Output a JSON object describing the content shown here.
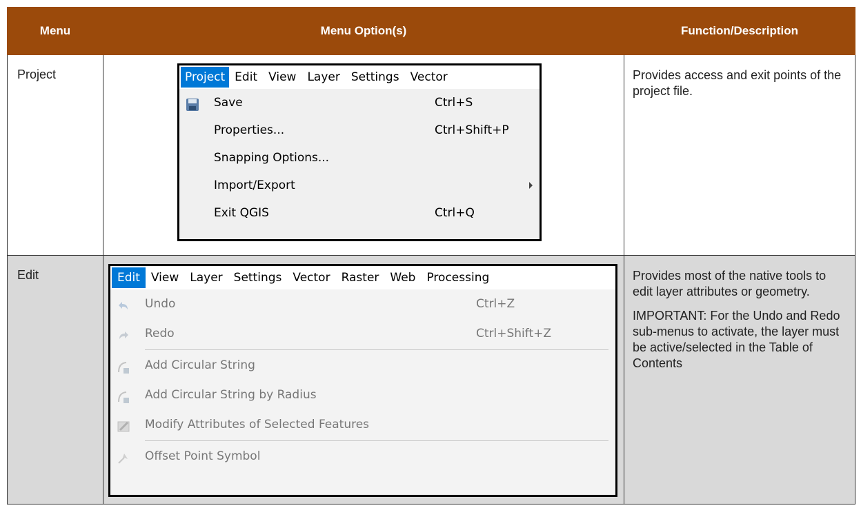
{
  "header": {
    "menu": "Menu",
    "options": "Menu Option(s)",
    "function": "Function/Description"
  },
  "rows": [
    {
      "menu": "Project",
      "description": [
        "Provides access and exit points of the project file."
      ],
      "shot": {
        "menubar": [
          "Project",
          "Edit",
          "View",
          "Layer",
          "Settings",
          "Vector"
        ],
        "items": [
          {
            "label": "Save",
            "shortcut": "Ctrl+S",
            "icon": "save-icon"
          },
          {
            "label": "Properties...",
            "shortcut": "Ctrl+Shift+P"
          },
          {
            "label": "Snapping Options...",
            "shortcut": ""
          },
          {
            "label": "Import/Export",
            "shortcut": "",
            "submenu": true
          },
          {
            "label": "Exit QGIS",
            "shortcut": "Ctrl+Q"
          }
        ]
      }
    },
    {
      "menu": "Edit",
      "description": [
        "Provides most of the native tools to edit layer attributes or geometry.",
        "IMPORTANT: For the Undo and Redo sub-menus to activate, the layer must be active/selected in the Table of Contents"
      ],
      "shot": {
        "menubar": [
          "Edit",
          "View",
          "Layer",
          "Settings",
          "Vector",
          "Raster",
          "Web",
          "Processing"
        ],
        "items": [
          {
            "label": "Undo",
            "shortcut": "Ctrl+Z",
            "icon": "undo-icon"
          },
          {
            "label": "Redo",
            "shortcut": "Ctrl+Shift+Z",
            "icon": "redo-icon"
          },
          {
            "label": "Add Circular String",
            "shortcut": "",
            "icon": "circular-string-icon"
          },
          {
            "label": "Add Circular String by Radius",
            "shortcut": "",
            "icon": "circular-string-radius-icon"
          },
          {
            "label": "Modify Attributes of Selected Features",
            "shortcut": "",
            "icon": "modify-attributes-icon"
          },
          {
            "label": "Offset Point Symbol",
            "shortcut": "",
            "icon": "offset-point-icon"
          }
        ]
      }
    }
  ]
}
